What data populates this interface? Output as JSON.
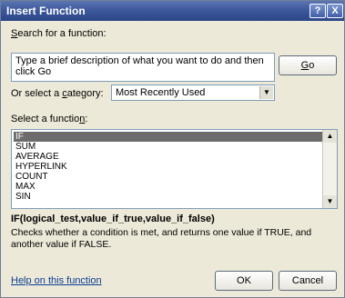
{
  "window": {
    "title": "Insert Function",
    "help_glyph": "?",
    "close_glyph": "X"
  },
  "search": {
    "label_pre": "",
    "label_hotkey": "S",
    "label_post": "earch for a function:",
    "value": "Type a brief description of what you want to do and then click Go",
    "go_label_hotkey": "G",
    "go_label_post": "o"
  },
  "category": {
    "label_pre": "Or select a ",
    "label_hotkey": "c",
    "label_post": "ategory:",
    "selected": "Most Recently Used"
  },
  "functions": {
    "label_pre": "Select a functio",
    "label_hotkey": "n",
    "label_post": ":",
    "items": [
      "IF",
      "SUM",
      "AVERAGE",
      "HYPERLINK",
      "COUNT",
      "MAX",
      "SIN"
    ],
    "selected_index": 0
  },
  "details": {
    "syntax": "IF(logical_test,value_if_true,value_if_false)",
    "description": "Checks whether a condition is met, and returns one value if TRUE, and another value if FALSE."
  },
  "footer": {
    "help_link": "Help on this function",
    "ok_label": "OK",
    "cancel_label": "Cancel"
  },
  "icons": {
    "dropdown": "chevron-down-icon",
    "scroll_up": "scroll-up-icon",
    "scroll_down": "scroll-down-icon"
  }
}
